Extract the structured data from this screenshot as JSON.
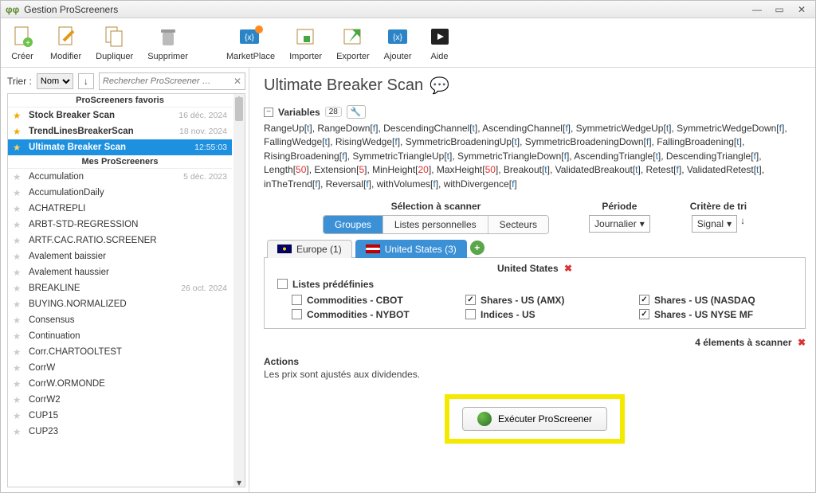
{
  "window": {
    "title": "Gestion ProScreeners"
  },
  "toolbar": [
    {
      "name": "create",
      "label": "Créer"
    },
    {
      "name": "modify",
      "label": "Modifier"
    },
    {
      "name": "duplicate",
      "label": "Dupliquer"
    },
    {
      "name": "delete",
      "label": "Supprimer"
    },
    {
      "name": "marketplace",
      "label": "MarketPlace"
    },
    {
      "name": "import",
      "label": "Importer"
    },
    {
      "name": "export",
      "label": "Exporter"
    },
    {
      "name": "add",
      "label": "Ajouter"
    },
    {
      "name": "help",
      "label": "Aide"
    }
  ],
  "left": {
    "sort_label": "Trier :",
    "sort_value": "Nom",
    "search_placeholder": "Rechercher ProScreener …",
    "section_fav": "ProScreeners favoris",
    "section_mine": "Mes ProScreeners",
    "fav": [
      {
        "name": "Stock Breaker Scan",
        "date": "16 déc. 2024"
      },
      {
        "name": "TrendLinesBreakerScan",
        "date": "18 nov. 2024"
      },
      {
        "name": "Ultimate Breaker Scan",
        "date": "12:55:03",
        "selected": true
      }
    ],
    "mine": [
      {
        "name": "Accumulation",
        "date": "5 déc. 2023"
      },
      {
        "name": "AccumulationDaily"
      },
      {
        "name": "ACHATREPLI"
      },
      {
        "name": "ARBT-STD-REGRESSION"
      },
      {
        "name": "ARTF.CAC.RATIO.SCREENER"
      },
      {
        "name": "Avalement baissier"
      },
      {
        "name": "Avalement haussier"
      },
      {
        "name": "BREAKLINE",
        "date": "26 oct. 2024"
      },
      {
        "name": "BUYING.NORMALIZED"
      },
      {
        "name": "Consensus"
      },
      {
        "name": "Continuation"
      },
      {
        "name": "Corr.CHARTOOLTEST"
      },
      {
        "name": "CorrW"
      },
      {
        "name": "CorrW.ORMONDE"
      },
      {
        "name": "CorrW2"
      },
      {
        "name": "CUP15"
      },
      {
        "name": "CUP23"
      }
    ]
  },
  "right": {
    "title": "Ultimate Breaker Scan",
    "var_label": "Variables",
    "var_count": "28",
    "vars": [
      [
        "RangeUp",
        "t"
      ],
      [
        "RangeDown",
        "f"
      ],
      [
        "DescendingChannel",
        "t"
      ],
      [
        "AscendingChannel",
        "f"
      ],
      [
        "SymmetricWedgeUp",
        "t"
      ],
      [
        "SymmetricWedgeDown",
        "f"
      ],
      [
        "FallingWedge",
        "t"
      ],
      [
        "RisingWedge",
        "f"
      ],
      [
        "SymmetricBroadeningUp",
        "t"
      ],
      [
        "SymmetricBroadeningDown",
        "f"
      ],
      [
        "FallingBroadening",
        "t"
      ],
      [
        "RisingBroadening",
        "f"
      ],
      [
        "SymmetricTriangleUp",
        "t"
      ],
      [
        "SymmetricTriangleDown",
        "f"
      ],
      [
        "AscendingTriangle",
        "t"
      ],
      [
        "DescendingTriangle",
        "f"
      ],
      [
        "Length",
        "50"
      ],
      [
        "Extension",
        "5"
      ],
      [
        "MinHeight",
        "20"
      ],
      [
        "MaxHeight",
        "50"
      ],
      [
        "Breakout",
        "t"
      ],
      [
        "ValidatedBreakout",
        "t"
      ],
      [
        "Retest",
        "f"
      ],
      [
        "ValidatedRetest",
        "t"
      ],
      [
        "inTheTrend",
        "f"
      ],
      [
        "Reversal",
        "f"
      ],
      [
        "withVolumes",
        "f"
      ],
      [
        "withDivergence",
        "f"
      ]
    ],
    "sel_label": "Sélection à scanner",
    "seg": [
      "Groupes",
      "Listes personnelles",
      "Secteurs"
    ],
    "period_label": "Période",
    "period_value": "Journalier",
    "crit_label": "Critère de tri",
    "crit_value": "Signal",
    "tabs": [
      {
        "flag": "eu",
        "label": "Europe (1)"
      },
      {
        "flag": "us",
        "label": "United States (3)",
        "active": true
      }
    ],
    "panel_title": "United States",
    "predef_label": "Listes prédéfinies",
    "checks": [
      {
        "label": "Commodities - CBOT",
        "checked": false
      },
      {
        "label": "Shares - US (AMX)",
        "checked": true
      },
      {
        "label": "Shares - US (NASDAQ",
        "checked": true
      },
      {
        "label": "Commodities - NYBOT",
        "checked": false
      },
      {
        "label": "Indices - US",
        "checked": false
      },
      {
        "label": "Shares - US NYSE MF",
        "checked": true
      }
    ],
    "summary": "4 élements à scanner",
    "actions_head": "Actions",
    "actions_text": "Les prix sont ajustés aux dividendes.",
    "exec_label": "Exécuter ProScreener"
  }
}
